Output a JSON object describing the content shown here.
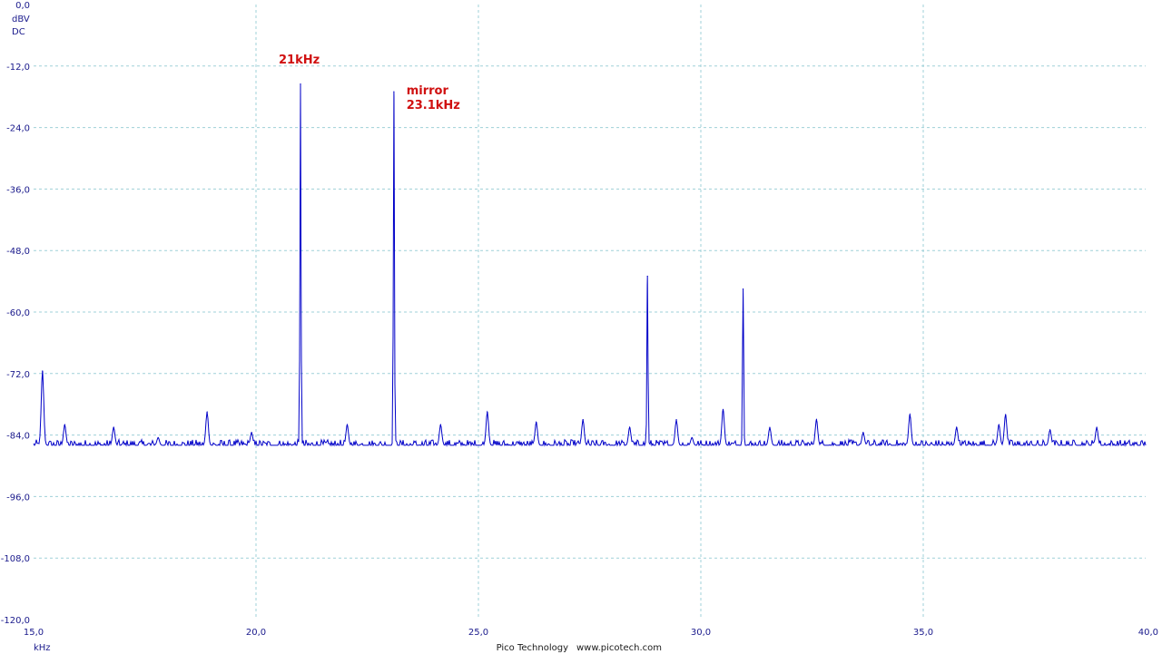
{
  "chart_data": {
    "type": "line",
    "y_unit": "dBV",
    "coupling": "DC",
    "x_unit": "kHz",
    "xlim": [
      15.0,
      40.0
    ],
    "ylim": [
      -120.0,
      0.0
    ],
    "x_ticks": [
      "15,0",
      "20,0",
      "25,0",
      "30,0",
      "35,0",
      "40,0"
    ],
    "y_ticks": [
      "0,0",
      "-12,0",
      "-24,0",
      "-36,0",
      "-48,0",
      "-60,0",
      "-72,0",
      "-84,0",
      "-96,0",
      "-108,0",
      "-120,0"
    ],
    "grid": true,
    "noise_floor_dbv": -86,
    "series": [
      {
        "peaks": [
          {
            "x": 15.2,
            "y": -71.5
          },
          {
            "x": 15.7,
            "y": -82
          },
          {
            "x": 16.8,
            "y": -82.5
          },
          {
            "x": 17.8,
            "y": -84.5
          },
          {
            "x": 18.9,
            "y": -79.5
          },
          {
            "x": 19.9,
            "y": -83.5
          },
          {
            "x": 21.0,
            "y": -15.5
          },
          {
            "x": 22.05,
            "y": -82
          },
          {
            "x": 23.1,
            "y": -17
          },
          {
            "x": 24.15,
            "y": -82
          },
          {
            "x": 25.2,
            "y": -79.5
          },
          {
            "x": 26.3,
            "y": -81.5
          },
          {
            "x": 27.35,
            "y": -81
          },
          {
            "x": 28.4,
            "y": -82.5
          },
          {
            "x": 28.8,
            "y": -53
          },
          {
            "x": 29.45,
            "y": -81
          },
          {
            "x": 29.8,
            "y": -84.5
          },
          {
            "x": 30.5,
            "y": -79
          },
          {
            "x": 30.95,
            "y": -55.5
          },
          {
            "x": 31.55,
            "y": -82.5
          },
          {
            "x": 32.6,
            "y": -81
          },
          {
            "x": 33.65,
            "y": -83.5
          },
          {
            "x": 34.7,
            "y": -80
          },
          {
            "x": 35.75,
            "y": -82.5
          },
          {
            "x": 36.7,
            "y": -82
          },
          {
            "x": 36.85,
            "y": -80
          },
          {
            "x": 37.85,
            "y": -83
          },
          {
            "x": 38.9,
            "y": -82.5
          }
        ]
      }
    ],
    "annotations": [
      {
        "lines": [
          "21kHz"
        ],
        "x": 21.0,
        "y": -11.5
      },
      {
        "lines": [
          "mirror",
          "23.1kHz"
        ],
        "x": 23.3,
        "y": -17.5
      }
    ]
  },
  "footer": {
    "vendor": "Pico Technology",
    "url": "www.picotech.com"
  }
}
